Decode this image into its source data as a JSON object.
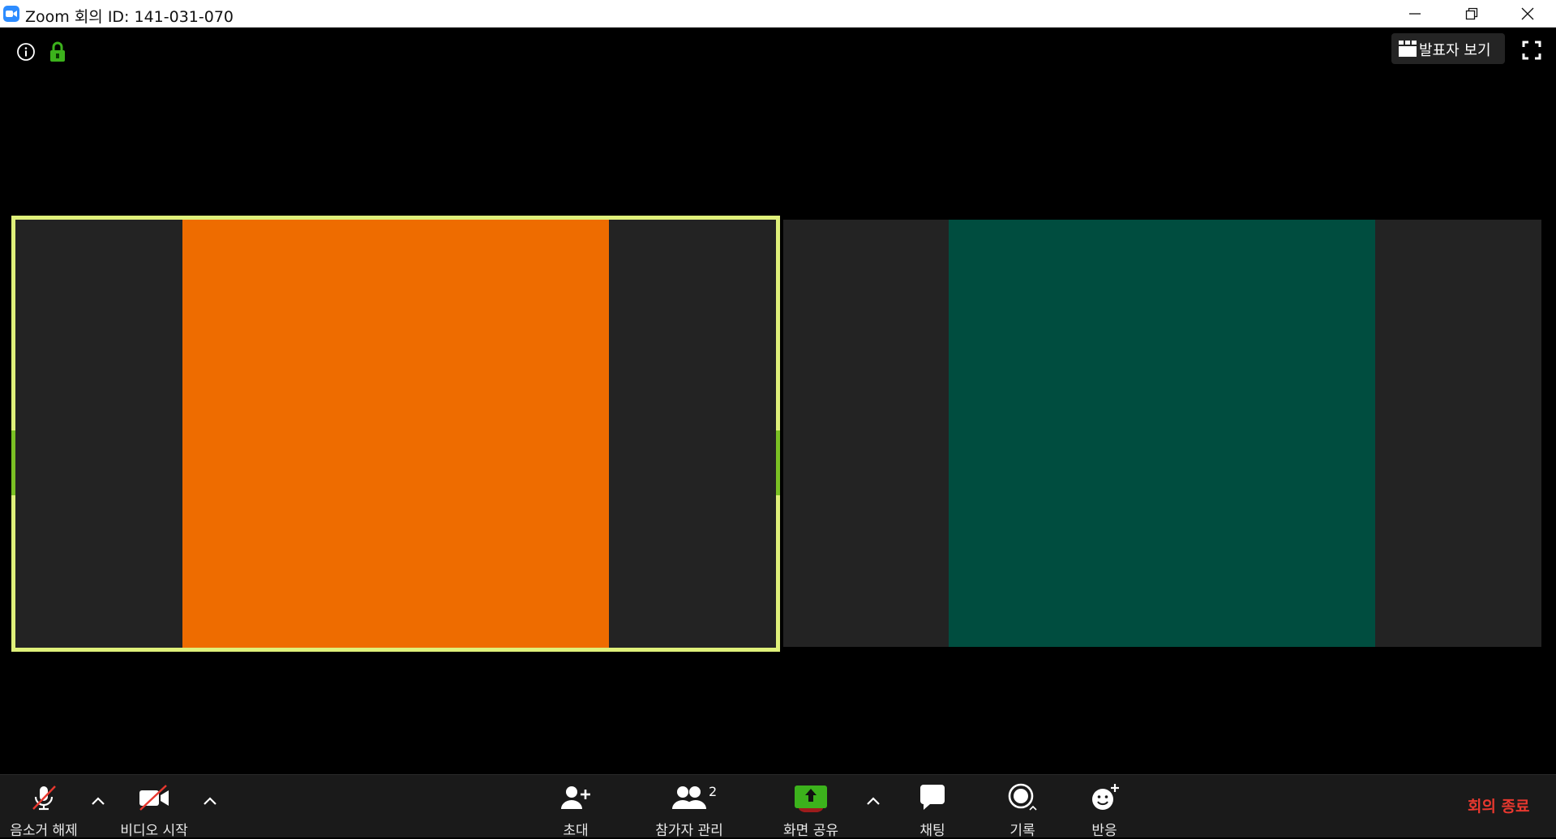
{
  "window": {
    "title": "Zoom 회의 ID: 141-031-070"
  },
  "top_right": {
    "speaker_view_label": "발표자 보기"
  },
  "toolbar": {
    "unmute_label": "음소거 해제",
    "start_video_label": "비디오 시작",
    "invite_label": "초대",
    "participants_label": "참가자 관리",
    "participant_count": "2",
    "share_screen_label": "화면 공유",
    "chat_label": "채팅",
    "record_label": "기록",
    "reactions_label": "반응",
    "end_meeting_label": "회의 종료"
  },
  "colors": {
    "active_speaker_border": "#dff07a",
    "participant_1_video": "#ee6c00",
    "participant_2_video": "#004d3f",
    "share_screen_green": "#3cb21c",
    "end_meeting_red": "#e8382f",
    "zoom_blue": "#2d8cff"
  },
  "icons": {
    "title": "zoom-logo-icon",
    "info": "info-icon",
    "lock": "lock-icon",
    "speaker_view": "speaker-view-icon",
    "fullscreen": "fullscreen-icon",
    "unmute": "muted-microphone-icon",
    "video": "video-off-icon",
    "invite": "add-person-icon",
    "participants": "participants-icon",
    "share": "share-screen-icon",
    "chat": "chat-bubble-icon",
    "record": "record-icon",
    "reactions": "emoji-add-icon"
  }
}
